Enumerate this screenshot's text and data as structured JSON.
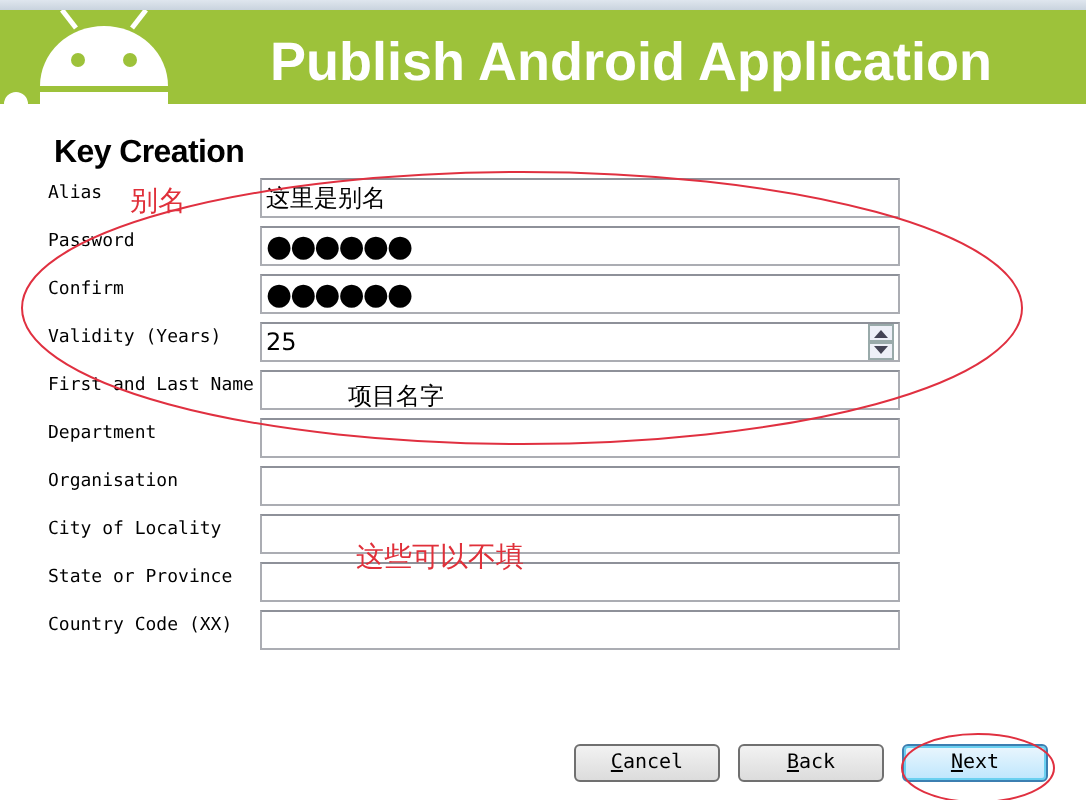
{
  "header": {
    "title": "Publish Android Application"
  },
  "section_title": "Key Creation",
  "fields": [
    {
      "label": "Alias",
      "kind": "text",
      "value": "这里是别名"
    },
    {
      "label": "Password",
      "kind": "password",
      "value": "●●●●●●"
    },
    {
      "label": "Confirm",
      "kind": "password",
      "value": "●●●●●●"
    },
    {
      "label": "Validity (Years)",
      "kind": "spinner",
      "value": "25"
    },
    {
      "label": "First and Last Name",
      "kind": "text"
    },
    {
      "label": "Department",
      "kind": "text"
    },
    {
      "label": "Organisation",
      "kind": "text"
    },
    {
      "label": "City of Locality",
      "kind": "text"
    },
    {
      "label": "State or Province",
      "kind": "text"
    },
    {
      "label": "Country Code (XX)",
      "kind": "text"
    }
  ],
  "buttons": [
    {
      "label": "Cancel",
      "default": false
    },
    {
      "label": "Back",
      "default": false
    },
    {
      "label": "Next",
      "default": true
    }
  ],
  "annotations": [
    {
      "text": "别名",
      "color": "#e0303a"
    },
    {
      "text": "项目名字",
      "color": "#000000"
    },
    {
      "text": "这些可以不填",
      "color": "#e0303a"
    }
  ]
}
